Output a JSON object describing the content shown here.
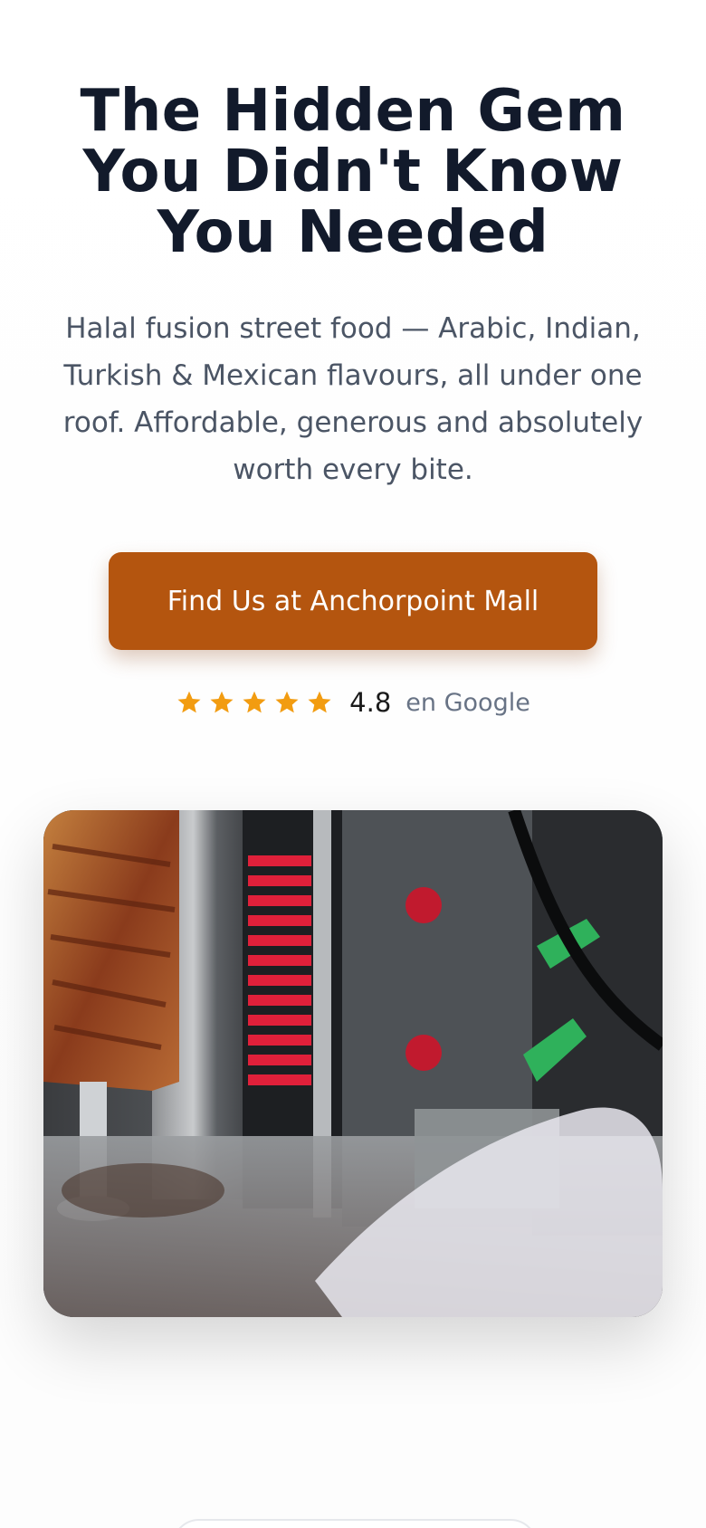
{
  "hero": {
    "title": "The Hidden Gem You Didn't Know You Needed",
    "subtitle": "Halal fusion street food — Arabic, Indian, Turkish & Mexican flavours, all under one roof. Affordable, generous and absolutely worth every bite."
  },
  "cta": {
    "label": "Find Us at Anchorpoint Mall"
  },
  "rating": {
    "value": "4.8",
    "source": "en Google",
    "stars": 5,
    "star_icon": "star-icon"
  },
  "colors": {
    "title": "#121a2b",
    "body_text": "#4b5565",
    "cta_background": "#b4550f",
    "cta_text": "#ffffff",
    "star": "#f29c11",
    "rating_source": "#687385"
  }
}
